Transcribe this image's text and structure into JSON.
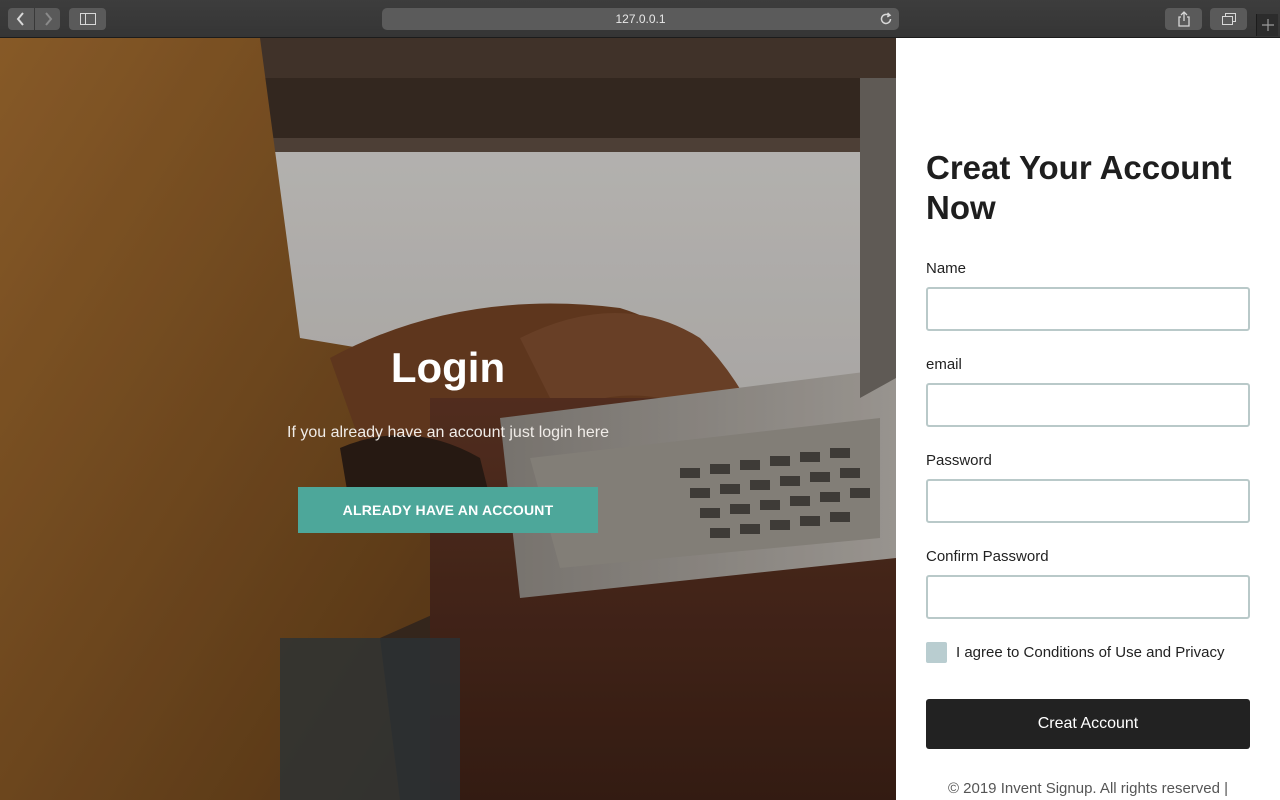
{
  "browser": {
    "url": "127.0.0.1",
    "icons": {
      "back": "chevron-left-icon",
      "forward": "chevron-right-icon",
      "sidebar": "sidebar-icon",
      "reload": "reload-icon",
      "share": "share-icon",
      "tabs": "tabs-icon",
      "new_tab": "plus-icon"
    }
  },
  "hero": {
    "title": "Login",
    "subtitle": "If you already have an account just login here",
    "button_label": "ALREADY HAVE AN ACCOUNT",
    "button_color": "#4da79a"
  },
  "signup": {
    "title": "Creat Your Account Now",
    "fields": [
      {
        "label": "Name",
        "value": "",
        "placeholder": ""
      },
      {
        "label": "email",
        "value": "",
        "placeholder": ""
      },
      {
        "label": "Password",
        "value": "",
        "placeholder": ""
      },
      {
        "label": "Confirm Password",
        "value": "",
        "placeholder": ""
      }
    ],
    "agree_text": "I agree to Conditions of Use and Privacy",
    "agree_checked": false,
    "submit_label": "Creat Account",
    "submit_color": "#222222",
    "footer": "© 2019 Invent Signup. All rights reserved |"
  }
}
